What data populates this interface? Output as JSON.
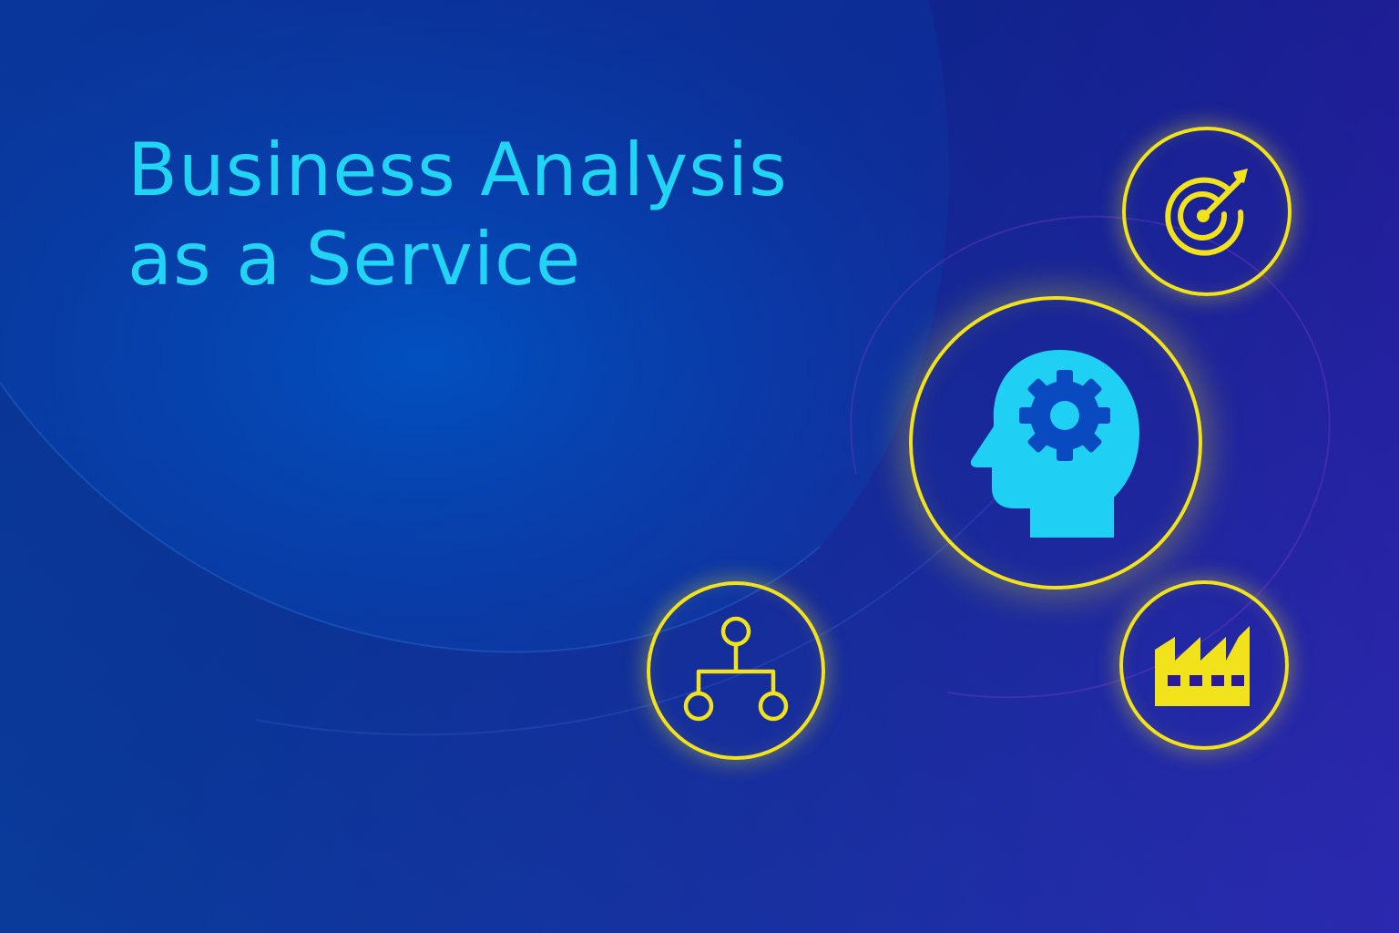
{
  "title": {
    "line1": "Business Analysis",
    "line2": "as a Service"
  },
  "colors": {
    "title": "#22d4f4",
    "ring": "#f2e21c",
    "head_icon": "#1fd0f4",
    "background_start": "#0a2a8c",
    "background_end": "#3a1ab2"
  },
  "icons": {
    "target": "target-arrow-icon",
    "head": "head-gear-icon",
    "org": "hierarchy-icon",
    "factory": "factory-icon"
  }
}
